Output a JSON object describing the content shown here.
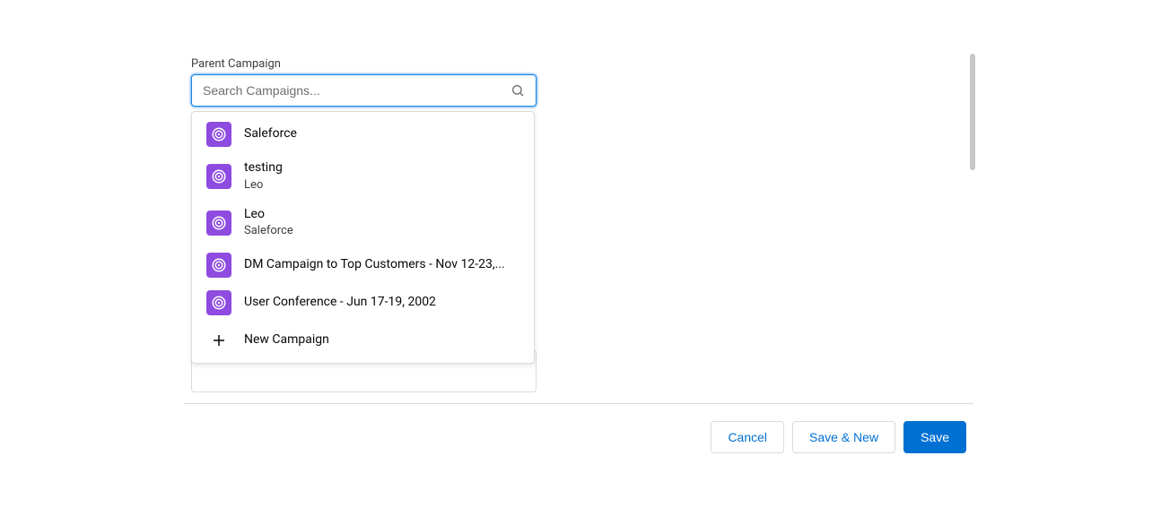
{
  "field": {
    "label": "Parent Campaign",
    "placeholder": "Search Campaigns..."
  },
  "dropdown": {
    "items": [
      {
        "title": "Saleforce",
        "sub": ""
      },
      {
        "title": "testing",
        "sub": "Leo"
      },
      {
        "title": "Leo",
        "sub": "Saleforce"
      },
      {
        "title": "DM Campaign to Top Customers - Nov 12-23,...",
        "sub": ""
      },
      {
        "title": "User Conference - Jun 17-19, 2002",
        "sub": ""
      }
    ],
    "new_label": "New Campaign"
  },
  "footer": {
    "cancel": "Cancel",
    "save_new": "Save & New",
    "save": "Save"
  },
  "colors": {
    "campaign_icon_bg": "#8E4BE0",
    "primary_button": "#0070D2",
    "focus_border": "#1589EE"
  }
}
